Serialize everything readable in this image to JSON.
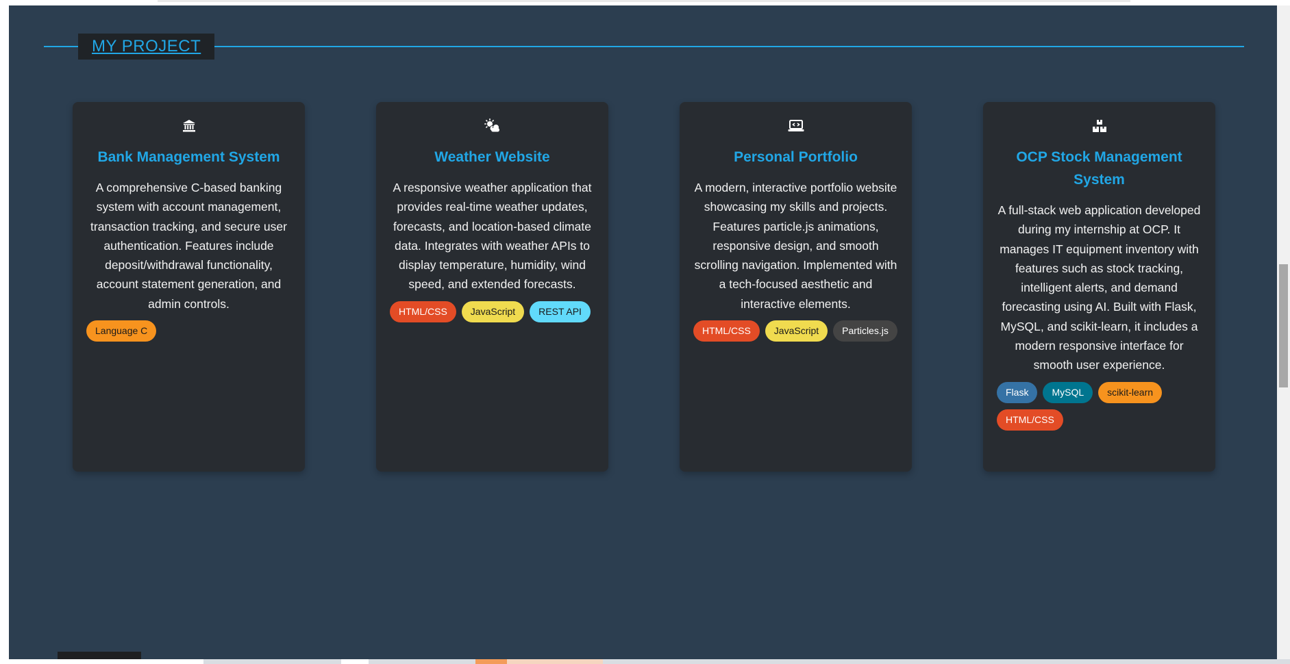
{
  "section": {
    "title": "MY PROJECT"
  },
  "projects": [
    {
      "icon": "bank-icon",
      "title": "Bank Management System",
      "description": "A comprehensive C-based banking system with account management, transaction tracking, and secure user authentication. Features include deposit/withdrawal functionality, account statement generation, and admin controls.",
      "tags": [
        {
          "label": "Language C",
          "color": "#f7931e",
          "text_color": "#1a1a1a"
        }
      ]
    },
    {
      "icon": "cloud-sun-icon",
      "title": "Weather Website",
      "description": "A responsive weather application that provides real-time weather updates, forecasts, and location-based climate data. Integrates with weather APIs to display temperature, humidity, wind speed, and extended forecasts.",
      "tags": [
        {
          "label": "HTML/CSS",
          "color": "#e34c26",
          "text_color": "#ffffff"
        },
        {
          "label": "JavaScript",
          "color": "#f0db4f",
          "text_color": "#1a1a1a"
        },
        {
          "label": "REST API",
          "color": "#61dafb",
          "text_color": "#1a1a1a"
        }
      ]
    },
    {
      "icon": "laptop-code-icon",
      "title": "Personal Portfolio",
      "description": "A modern, interactive portfolio website showcasing my skills and projects. Features particle.js animations, responsive design, and smooth scrolling navigation. Implemented with a tech-focused aesthetic and interactive elements.",
      "tags": [
        {
          "label": "HTML/CSS",
          "color": "#e34c26",
          "text_color": "#ffffff"
        },
        {
          "label": "JavaScript",
          "color": "#f0db4f",
          "text_color": "#1a1a1a"
        },
        {
          "label": "Particles.js",
          "color": "#444444",
          "text_color": "#ffffff"
        }
      ]
    },
    {
      "icon": "boxes-icon",
      "title": "OCP Stock Management System",
      "description": "A full-stack web application developed during my internship at OCP. It manages IT equipment inventory with features such as stock tracking, intelligent alerts, and demand forecasting using AI. Built with Flask, MySQL, and scikit-learn, it includes a modern responsive interface for smooth user experience.",
      "tags": [
        {
          "label": "Flask",
          "color": "#3572a5",
          "text_color": "#ffffff"
        },
        {
          "label": "MySQL",
          "color": "#00758f",
          "text_color": "#ffffff"
        },
        {
          "label": "scikit-learn",
          "color": "#f7931e",
          "text_color": "#1a1a1a"
        },
        {
          "label": "HTML/CSS",
          "color": "#e34c26",
          "text_color": "#ffffff"
        }
      ]
    }
  ],
  "colors": {
    "background": "#2c3e50",
    "card": "#282c31",
    "accent": "#21a7e6",
    "text": "#f2f2f2"
  }
}
